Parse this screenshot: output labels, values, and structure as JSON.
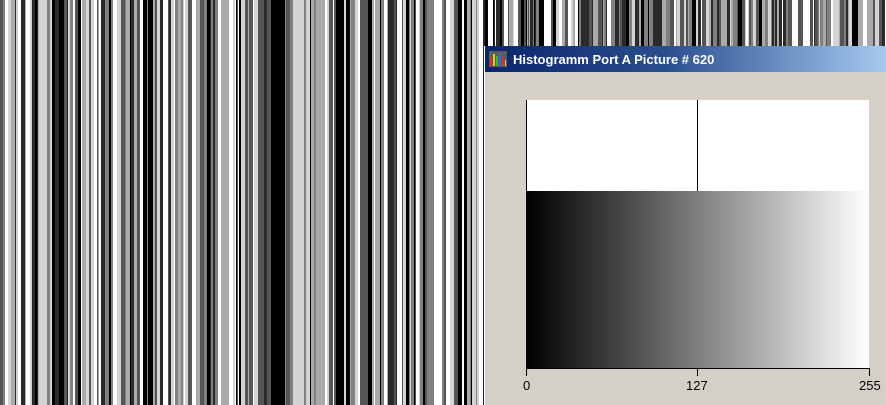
{
  "window": {
    "title": "Histogramm Port A Picture # 620",
    "icon": "histogram-app-icon"
  },
  "background_image": {
    "description_type": "vertical-barcode-stripes",
    "colors": [
      "#000000",
      "#2a2a2a",
      "#555555",
      "#808080",
      "#aaaaaa",
      "#d4d4d4",
      "#ffffff"
    ]
  },
  "histogram": {
    "x_ticks": [
      "0",
      "127",
      "255"
    ],
    "marker_value": 127,
    "gradient_start_color": "#000000",
    "gradient_end_color": "#ffffff",
    "plot_background": "#ffffff",
    "window_background": "#d4d0c8",
    "title_bar_colors": [
      "#0a246a",
      "#a6caf0"
    ]
  }
}
